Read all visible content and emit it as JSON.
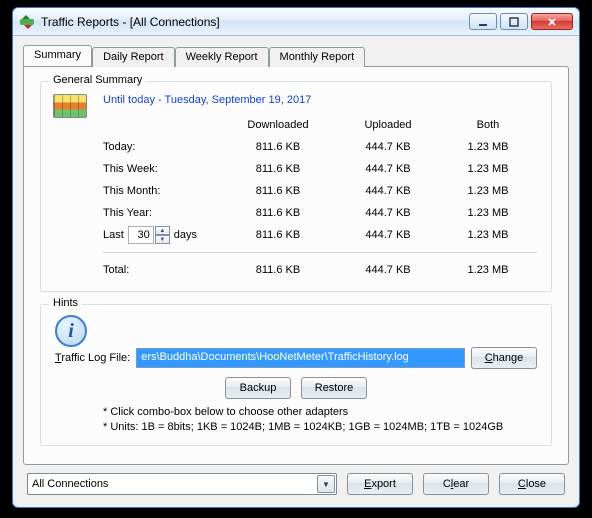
{
  "window": {
    "title": "Traffic Reports - [All Connections]"
  },
  "tabs": {
    "summary": "Summary",
    "daily": "Daily Report",
    "weekly": "Weekly Report",
    "monthly": "Monthly Report"
  },
  "general": {
    "legend": "General Summary",
    "caption": "Until today - Tuesday, September 19, 2017",
    "cols": {
      "down": "Downloaded",
      "up": "Uploaded",
      "both": "Both"
    },
    "rows": {
      "today": {
        "label": "Today:",
        "down": "811.6 KB",
        "up": "444.7 KB",
        "both": "1.23 MB"
      },
      "week": {
        "label": "This Week:",
        "down": "811.6 KB",
        "up": "444.7 KB",
        "both": "1.23 MB"
      },
      "month": {
        "label": "This Month:",
        "down": "811.6 KB",
        "up": "444.7 KB",
        "both": "1.23 MB"
      },
      "year": {
        "label": "This Year:",
        "down": "811.6 KB",
        "up": "444.7 KB",
        "both": "1.23 MB"
      },
      "lastn": {
        "prefix": "Last",
        "value": "30",
        "suffix": "days",
        "down": "811.6 KB",
        "up": "444.7 KB",
        "both": "1.23 MB"
      },
      "total": {
        "label": "Total:",
        "down": "811.6 KB",
        "up": "444.7 KB",
        "both": "1.23 MB"
      }
    }
  },
  "hints": {
    "legend": "Hints",
    "log_prefix": "T",
    "log_label_rest": "raffic Log File:",
    "log_value": "ers\\Buddha\\Documents\\HooNetMeter\\TrafficHistory.log",
    "change_u": "C",
    "change_rest": "hange",
    "backup_u": "B",
    "backup_rest": "ackup",
    "restore_u": "R",
    "restore_rest": "estore",
    "note1": "* Click combo-box below to choose other adapters",
    "note2": "* Units: 1B = 8bits; 1KB = 1024B; 1MB = 1024KB; 1GB = 1024MB; 1TB = 1024GB"
  },
  "footer": {
    "combo": "All Connections",
    "export_u": "E",
    "export_rest": "xport",
    "clear_u": "l",
    "clear_pre": "C",
    "clear_post": "ear",
    "close_u": "C",
    "close_rest": "lose"
  }
}
